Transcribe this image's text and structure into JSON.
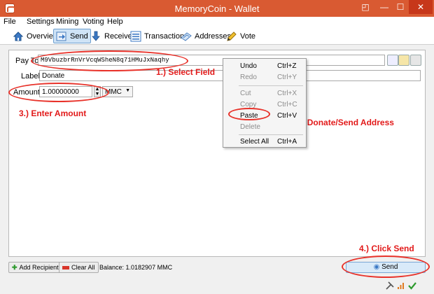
{
  "window": {
    "title": "MemoryCoin - Wallet",
    "minimize": "—",
    "maximize": "☐",
    "close": "✕",
    "pin": "◰"
  },
  "menu": [
    "File",
    "Settings",
    "Mining",
    "Voting",
    "Help"
  ],
  "toolbar": {
    "overview": "Overview",
    "send": "Send",
    "receive": "Receive",
    "transactions": "Transactions",
    "addresses": "Addresses",
    "vote": "Vote"
  },
  "form": {
    "pay_to_label": "Pay To:",
    "pay_to_value": "M9VbuzbrRnVrVcqWSheN8q71HMuJxNaqhy",
    "label_label": "Label:",
    "label_value": "Donate",
    "amount_label": "Amount:",
    "amount_value": "1.00000000",
    "unit": "MMC"
  },
  "context_menu": [
    {
      "label": "Undo",
      "shortcut": "Ctrl+Z",
      "enabled": true
    },
    {
      "label": "Redo",
      "shortcut": "Ctrl+Y",
      "enabled": false
    },
    {
      "label": "Cut",
      "shortcut": "Ctrl+X",
      "enabled": false
    },
    {
      "label": "Copy",
      "shortcut": "Ctrl+C",
      "enabled": false
    },
    {
      "label": "Paste",
      "shortcut": "Ctrl+V",
      "enabled": true
    },
    {
      "label": "Delete",
      "shortcut": "",
      "enabled": false
    },
    {
      "label": "Select All",
      "shortcut": "Ctrl+A",
      "enabled": true
    }
  ],
  "annotations": {
    "step1": "1.) Select Field",
    "step2": "2.) Paste Donate/Send Address",
    "step3": "3.) Enter Amount",
    "step4": "4.) Click Send"
  },
  "bottom": {
    "add_recipient": "Add Recipient",
    "clear_all": "Clear All",
    "balance": "Balance: 1.0182907 MMC",
    "send": "Send"
  },
  "colors": {
    "titlebar": "#d95a32",
    "annotation": "#e21a1a",
    "send_button": "#d9eaf9"
  }
}
